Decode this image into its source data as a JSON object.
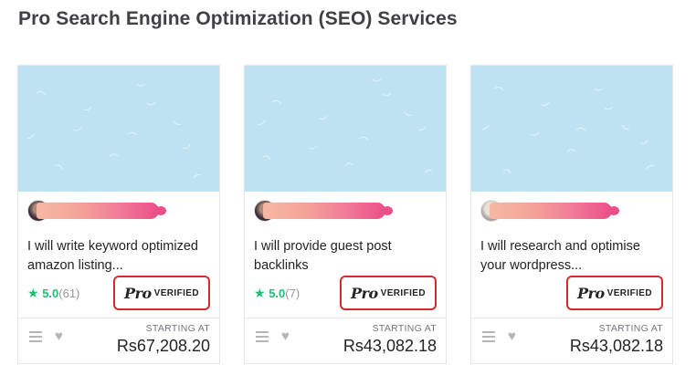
{
  "section": {
    "title": "Pro Search Engine Optimization (SEO) Services"
  },
  "colors": {
    "thumbnail_bg": "#bfe2f2",
    "accent_green": "#1dbf73",
    "highlight_red": "#d42b2b"
  },
  "cards": [
    {
      "title": "I will write keyword optimized amazon listing...",
      "rating": {
        "score": "5.0",
        "count": "(61)"
      },
      "pro_logo": "Pro",
      "verified": "VERIFIED",
      "starting_at": "STARTING AT",
      "price": "Rs67,208.20"
    },
    {
      "title": "I will provide guest post backlinks",
      "rating": {
        "score": "5.0",
        "count": "(7)"
      },
      "pro_logo": "Pro",
      "verified": "VERIFIED",
      "starting_at": "STARTING AT",
      "price": "Rs43,082.18"
    },
    {
      "title": "I will research and optimise your wordpress...",
      "pro_logo": "Pro",
      "verified": "VERIFIED",
      "starting_at": "STARTING AT",
      "price": "Rs43,082.18"
    }
  ],
  "icons": {
    "star": "star-icon",
    "menu": "menu-icon",
    "heart": "heart-icon"
  }
}
